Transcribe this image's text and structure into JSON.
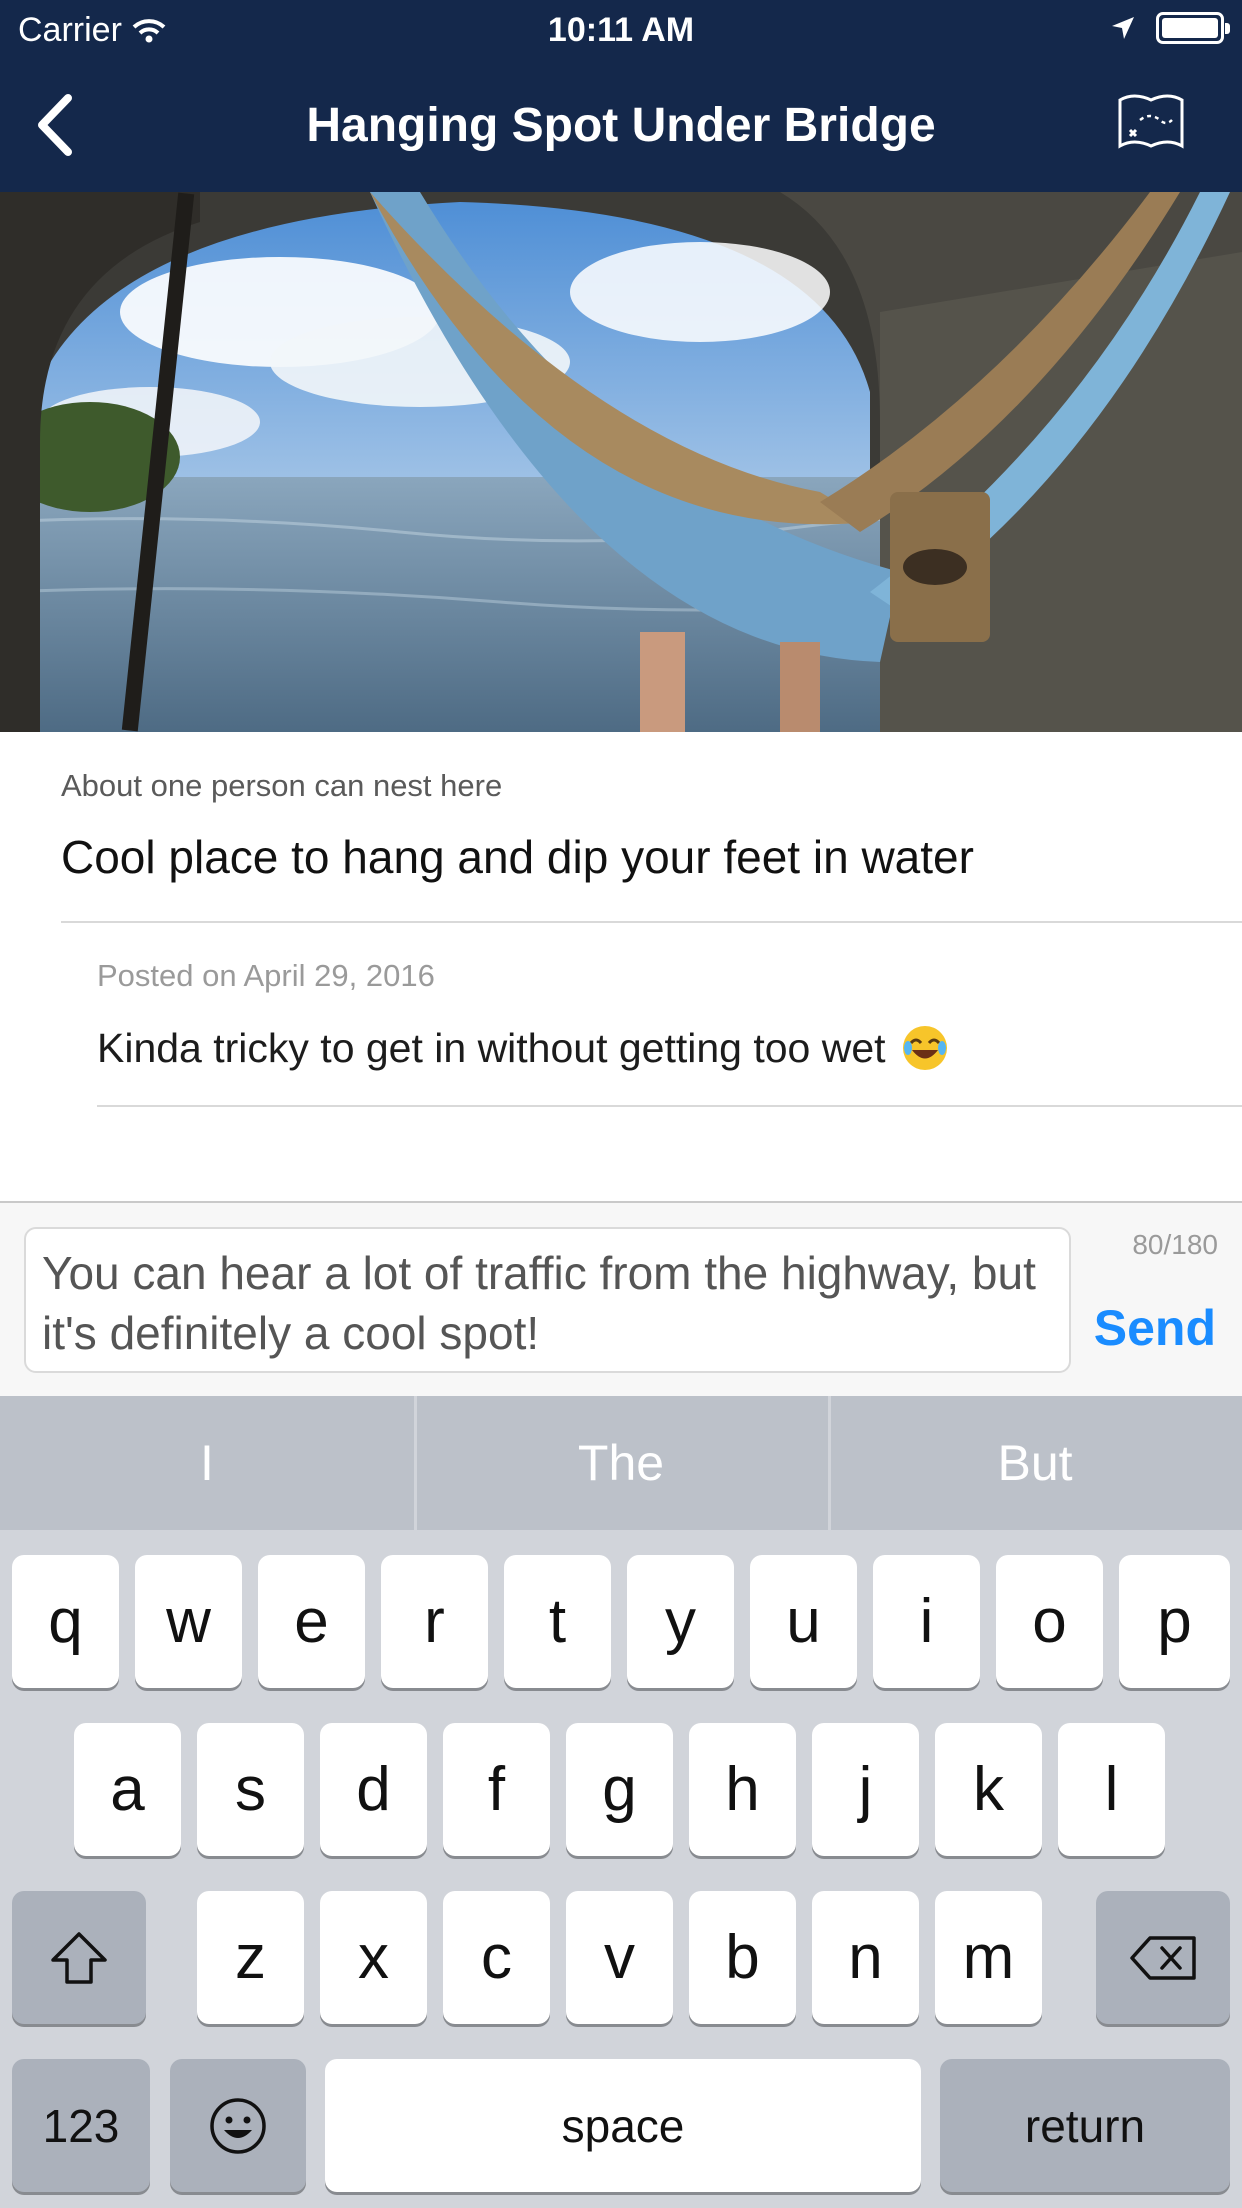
{
  "status_bar": {
    "carrier": "Carrier",
    "time": "10:11 AM"
  },
  "nav": {
    "title": "Hanging Spot Under Bridge"
  },
  "spot": {
    "capacity": "About one person can nest here",
    "description": "Cool place to hang and dip your feet in water"
  },
  "comment": {
    "date": "Posted on April 29, 2016",
    "text": "Kinda tricky to get in without getting too wet"
  },
  "composer": {
    "value": "You can hear a lot of traffic from the highway, but it's definitely a cool spot!",
    "counter": "80/180",
    "send_label": "Send"
  },
  "keyboard": {
    "suggestions": [
      "I",
      "The",
      "But"
    ],
    "row1": [
      "q",
      "w",
      "e",
      "r",
      "t",
      "y",
      "u",
      "i",
      "o",
      "p"
    ],
    "row2": [
      "a",
      "s",
      "d",
      "f",
      "g",
      "h",
      "j",
      "k",
      "l"
    ],
    "row3": [
      "z",
      "x",
      "c",
      "v",
      "b",
      "n",
      "m"
    ],
    "numbers_label": "123",
    "space_label": "space",
    "return_label": "return"
  },
  "colors": {
    "nav_bg": "#14284b",
    "accent": "#1a8cff"
  },
  "icons": [
    "wifi-icon",
    "location-arrow-icon",
    "battery-icon",
    "back-chevron-icon",
    "map-icon",
    "laughing-emoji-icon",
    "shift-icon",
    "backspace-icon",
    "emoji-icon"
  ]
}
